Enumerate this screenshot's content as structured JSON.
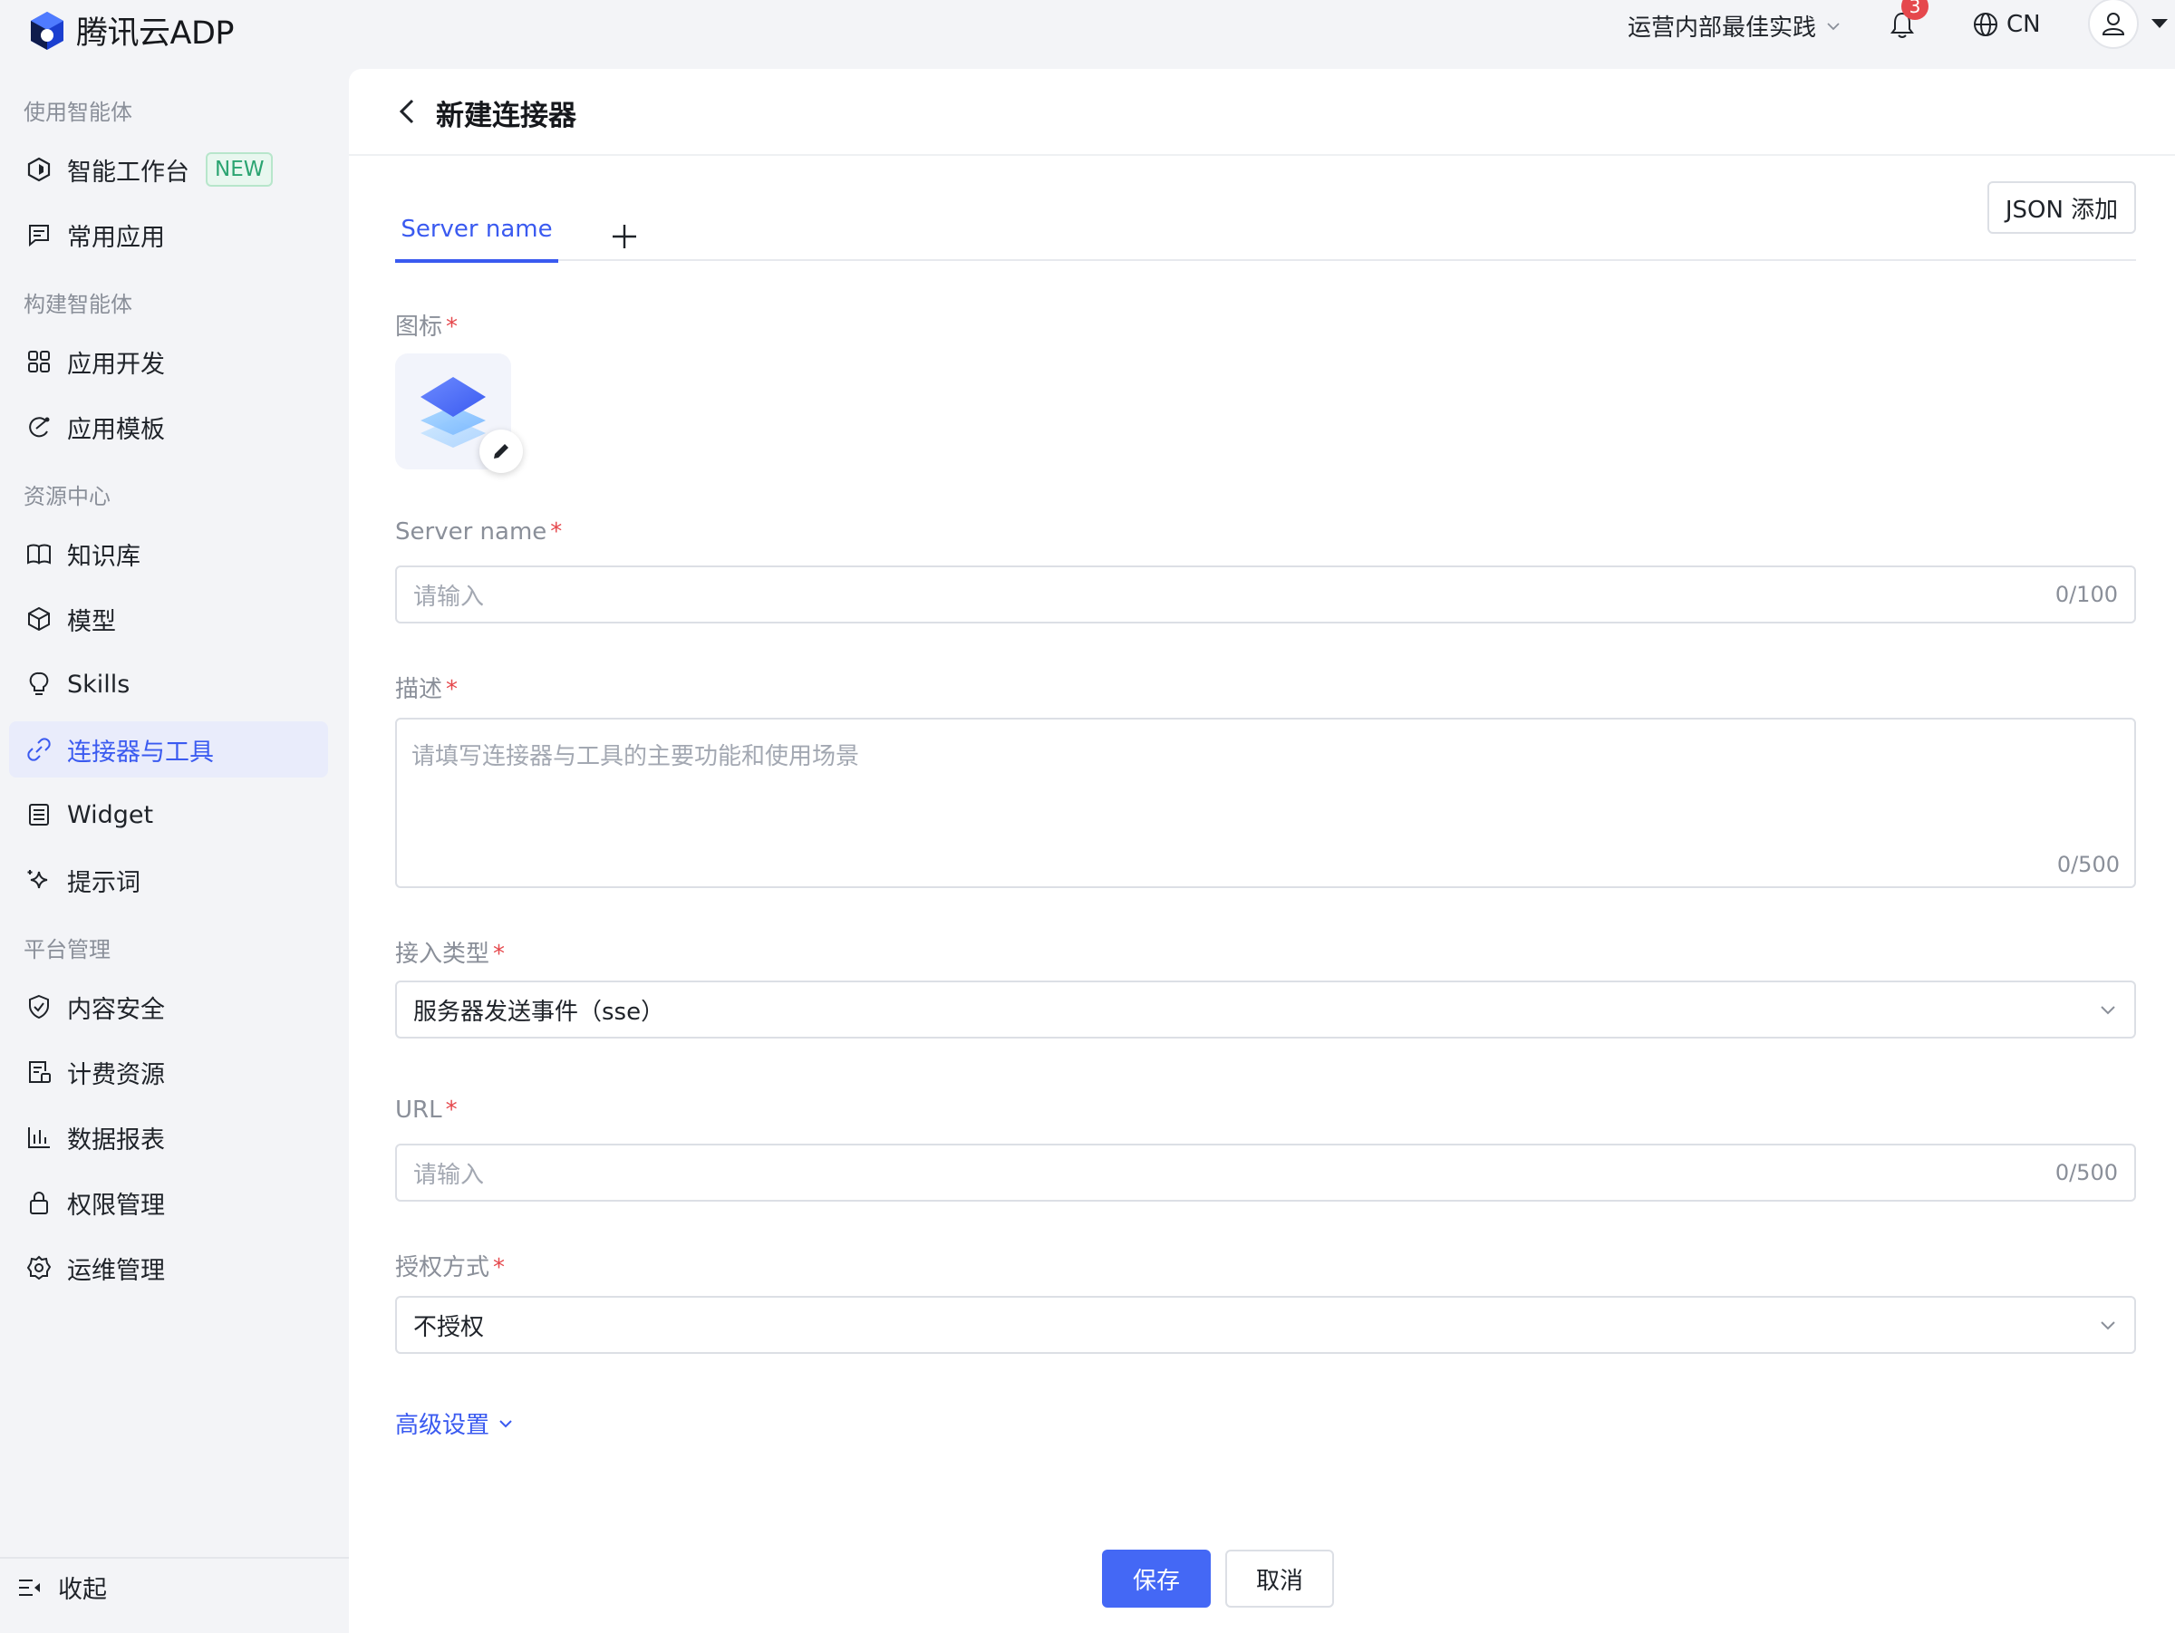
{
  "app": {
    "logo_text": "腾讯云ADP"
  },
  "topbar": {
    "org": "运营内部最佳实践",
    "notification_count": "3",
    "language": "CN"
  },
  "sidebar": {
    "groups": [
      {
        "title": "使用智能体"
      },
      {
        "title": "构建智能体"
      },
      {
        "title": "资源中心"
      },
      {
        "title": "平台管理"
      }
    ],
    "items": [
      {
        "label": "智能工作台",
        "tag": "NEW",
        "icon": "workspace-icon"
      },
      {
        "label": "常用应用",
        "icon": "message-icon"
      },
      {
        "label": "应用开发",
        "icon": "grid-icon"
      },
      {
        "label": "应用模板",
        "icon": "template-icon"
      },
      {
        "label": "知识库",
        "icon": "book-icon"
      },
      {
        "label": "模型",
        "icon": "cube-icon"
      },
      {
        "label": "Skills",
        "icon": "bulb-icon"
      },
      {
        "label": "连接器与工具",
        "icon": "link-icon",
        "active": true
      },
      {
        "label": "Widget",
        "icon": "widget-icon"
      },
      {
        "label": "提示词",
        "icon": "sparkle-icon"
      },
      {
        "label": "内容安全",
        "icon": "shield-icon"
      },
      {
        "label": "计费资源",
        "icon": "billing-icon"
      },
      {
        "label": "数据报表",
        "icon": "chart-icon"
      },
      {
        "label": "权限管理",
        "icon": "lock-icon"
      },
      {
        "label": "运维管理",
        "icon": "gear-icon"
      }
    ],
    "collapse_label": "收起"
  },
  "page": {
    "title": "新建连接器",
    "tab_label": "Server name",
    "json_button": "JSON 添加",
    "required_mark": "*",
    "fields": {
      "icon_label": "图标",
      "server_name_label": "Server name",
      "server_name_placeholder": "请输入",
      "server_name_counter": "0/100",
      "description_label": "描述",
      "description_placeholder": "请填写连接器与工具的主要功能和使用场景",
      "description_counter": "0/500",
      "access_type_label": "接入类型",
      "access_type_value": "服务器发送事件（sse）",
      "url_label": "URL",
      "url_placeholder": "请输入",
      "url_counter": "0/500",
      "auth_label": "授权方式",
      "auth_value": "不授权"
    },
    "advanced_label": "高级设置",
    "save_button": "保存",
    "cancel_button": "取消"
  },
  "colors": {
    "accent": "#3a5af0",
    "primary_button": "#4468f5",
    "required": "#e5484d",
    "new_tag": "#2ba471"
  }
}
